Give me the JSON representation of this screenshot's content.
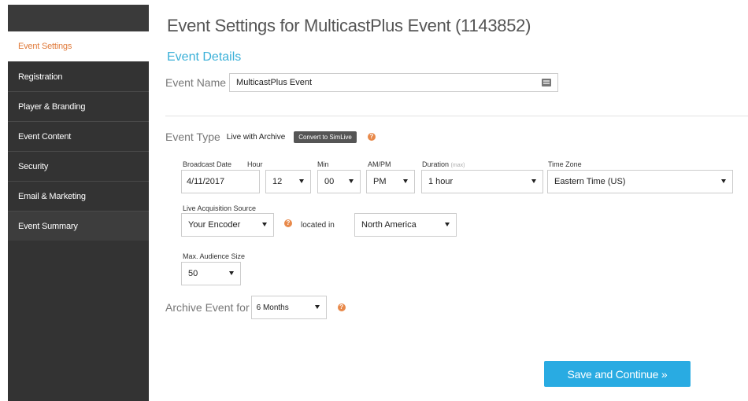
{
  "sidebar": {
    "items": [
      {
        "label": "Event Settings",
        "active": true
      },
      {
        "label": "Registration"
      },
      {
        "label": "Player & Branding"
      },
      {
        "label": "Event Content"
      },
      {
        "label": "Security"
      },
      {
        "label": "Email & Marketing"
      },
      {
        "label": "Event Summary"
      }
    ]
  },
  "page": {
    "title": "Event Settings for MulticastPlus Event (1143852)",
    "section_title": "Event Details"
  },
  "event_name": {
    "label": "Event Name",
    "value": "MulticastPlus Event"
  },
  "event_type": {
    "label": "Event Type",
    "value": "Live with Archive",
    "convert_button": "Convert to SimLive",
    "help": "?"
  },
  "broadcast": {
    "date_label": "Broadcast Date",
    "date_value": "4/11/2017",
    "hour_label": "Hour",
    "hour_value": "12",
    "min_label": "Min",
    "min_value": "00",
    "ampm_label": "AM/PM",
    "ampm_value": "PM",
    "duration_label": "Duration",
    "duration_hint": "(max)",
    "duration_value": "1 hour",
    "timezone_label": "Time Zone",
    "timezone_value": "Eastern Time (US)"
  },
  "acquisition": {
    "label": "Live Acquisition Source",
    "value": "Your Encoder",
    "help": "?",
    "located_label": "located in",
    "region_value": "North America"
  },
  "audience": {
    "label": "Max. Audience Size",
    "value": "50"
  },
  "archive": {
    "label": "Archive Event for",
    "value": "6 Months",
    "help": "?"
  },
  "save_button": "Save and Continue »",
  "colors": {
    "sidebar_bg": "#333333",
    "active_text": "#e07a3a",
    "accent": "#29abe2",
    "help_icon": "#e8894a"
  }
}
